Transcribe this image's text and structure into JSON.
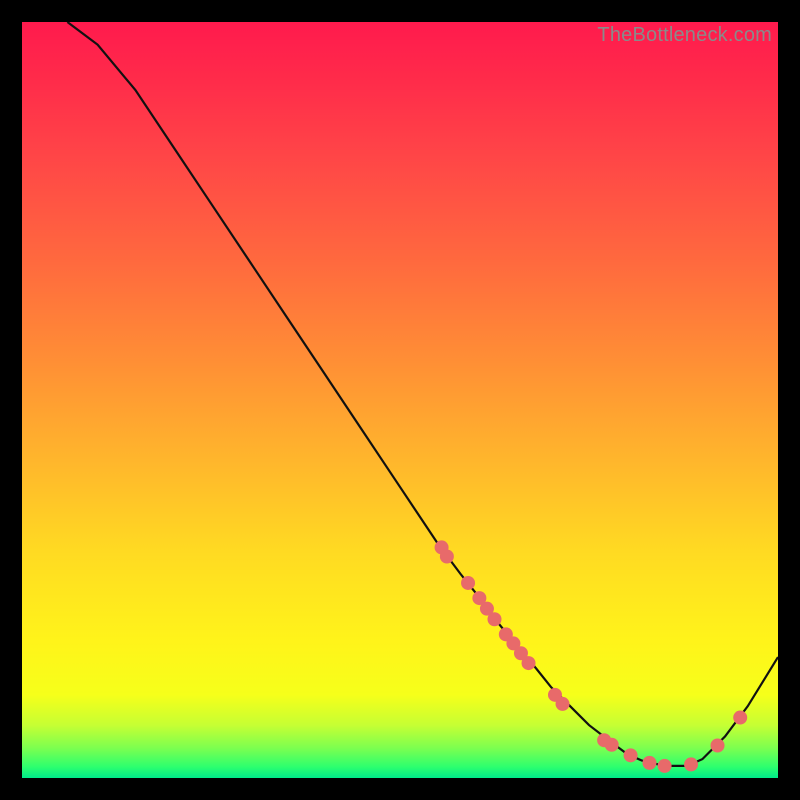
{
  "watermark": "TheBottleneck.com",
  "colors": {
    "curve": "#111111",
    "marker": "#e86a6a",
    "frame_bg": "#000000"
  },
  "chart_data": {
    "type": "line",
    "title": "",
    "xlabel": "",
    "ylabel": "",
    "xlim": [
      0,
      100
    ],
    "ylim": [
      0,
      100
    ],
    "curve": {
      "x": [
        6,
        10,
        15,
        20,
        25,
        30,
        35,
        40,
        45,
        50,
        55,
        58,
        60,
        63,
        65,
        68,
        70,
        73,
        75,
        78,
        80,
        82,
        85,
        88,
        90,
        93,
        96,
        100
      ],
      "y": [
        100,
        97,
        91,
        83.5,
        76,
        68.5,
        61,
        53.5,
        46,
        38.5,
        31,
        27,
        24.5,
        20.5,
        18,
        14.5,
        12,
        9,
        7,
        4.7,
        3.2,
        2.3,
        1.6,
        1.6,
        2.5,
        5.5,
        9.5,
        16
      ]
    },
    "markers": [
      {
        "x": 55.5,
        "y": 30.5
      },
      {
        "x": 56.2,
        "y": 29.3
      },
      {
        "x": 59,
        "y": 25.8
      },
      {
        "x": 60.5,
        "y": 23.8
      },
      {
        "x": 61.5,
        "y": 22.4
      },
      {
        "x": 62.5,
        "y": 21
      },
      {
        "x": 64,
        "y": 19
      },
      {
        "x": 65,
        "y": 17.8
      },
      {
        "x": 66,
        "y": 16.5
      },
      {
        "x": 67,
        "y": 15.2
      },
      {
        "x": 70.5,
        "y": 11
      },
      {
        "x": 71.5,
        "y": 9.8
      },
      {
        "x": 77,
        "y": 5
      },
      {
        "x": 78,
        "y": 4.4
      },
      {
        "x": 80.5,
        "y": 3
      },
      {
        "x": 83,
        "y": 2
      },
      {
        "x": 85,
        "y": 1.6
      },
      {
        "x": 88.5,
        "y": 1.8
      },
      {
        "x": 92,
        "y": 4.3
      },
      {
        "x": 95,
        "y": 8
      }
    ],
    "marker_radius": 7
  }
}
